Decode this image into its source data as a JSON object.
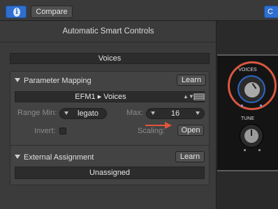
{
  "toolbar": {
    "info_icon": "i",
    "compare_label": "Compare",
    "right_button_label": "C"
  },
  "panel": {
    "title": "Automatic Smart Controls",
    "control_name": "Voices"
  },
  "parameter_mapping": {
    "header": "Parameter Mapping",
    "learn_label": "Learn",
    "target": "EFM1 ▸ Voices",
    "range_min_label": "Range Min:",
    "range_min_value": "legato",
    "max_label": "Max:",
    "max_value": "16",
    "invert_label": "Invert:",
    "scaling_label": "Scaling:",
    "open_label": "Open"
  },
  "external_assignment": {
    "header": "External Assignment",
    "learn_label": "Learn",
    "status": "Unassigned"
  },
  "smart_controls": {
    "knob_voices_label": "VOICES",
    "knob_tune_label": "TUNE",
    "highlight_color": "#d9573f",
    "accent_color": "#2f6fd0"
  },
  "callout": {
    "arrow_color": "#e2553b"
  }
}
